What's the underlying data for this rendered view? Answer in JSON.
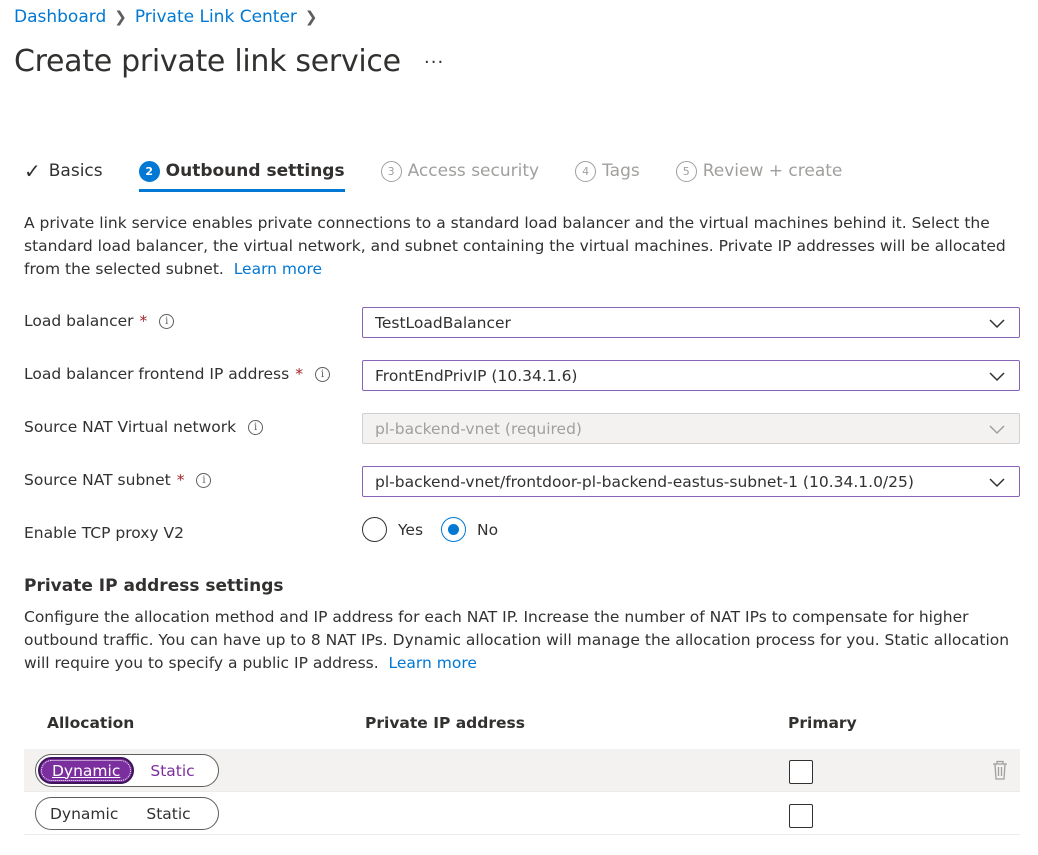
{
  "breadcrumb": {
    "items": [
      "Dashboard",
      "Private Link Center"
    ]
  },
  "page": {
    "title": "Create private link service",
    "more": "···"
  },
  "tabs": [
    {
      "label": "Basics",
      "state": "done"
    },
    {
      "number": "2",
      "label": "Outbound settings",
      "state": "active"
    },
    {
      "number": "3",
      "label": "Access security",
      "state": "pending"
    },
    {
      "number": "4",
      "label": "Tags",
      "state": "pending"
    },
    {
      "number": "5",
      "label": "Review + create",
      "state": "pending"
    }
  ],
  "intro": {
    "text": "A private link service enables private connections to a standard load balancer and the virtual machines behind it. Select the standard load balancer, the virtual network, and subnet containing the virtual machines. Private IP addresses will be allocated from the selected subnet.",
    "learn_more": "Learn more"
  },
  "form": {
    "load_balancer": {
      "label": "Load balancer",
      "required": "*",
      "value": "TestLoadBalancer"
    },
    "frontend_ip": {
      "label": "Load balancer frontend IP address",
      "required": "*",
      "value": "FrontEndPrivIP (10.34.1.6)"
    },
    "nat_vnet": {
      "label": "Source NAT Virtual network",
      "value": "pl-backend-vnet (required)"
    },
    "nat_subnet": {
      "label": "Source NAT subnet",
      "required": "*",
      "value": "pl-backend-vnet/frontdoor-pl-backend-eastus-subnet-1 (10.34.1.0/25)"
    },
    "tcp_proxy": {
      "label": "Enable TCP proxy V2",
      "yes": "Yes",
      "no": "No",
      "selected": "No"
    }
  },
  "private_ip": {
    "title": "Private IP address settings",
    "text": "Configure the allocation method and IP address for each NAT IP. Increase the number of NAT IPs to compensate for higher outbound traffic. You can have up to 8 NAT IPs. Dynamic allocation will manage the allocation process for you. Static allocation will require you to specify a public IP address.",
    "learn_more": "Learn more",
    "columns": {
      "allocation": "Allocation",
      "ip": "Private IP address",
      "primary": "Primary"
    },
    "rows": [
      {
        "dynamic": "Dynamic",
        "static": "Static"
      },
      {
        "dynamic": "Dynamic",
        "static": "Static"
      }
    ]
  },
  "icons": {
    "info": "i"
  },
  "colors": {
    "accent": "#0078d4",
    "purple": "#7b2f9e",
    "focus_border": "#8764b8"
  }
}
